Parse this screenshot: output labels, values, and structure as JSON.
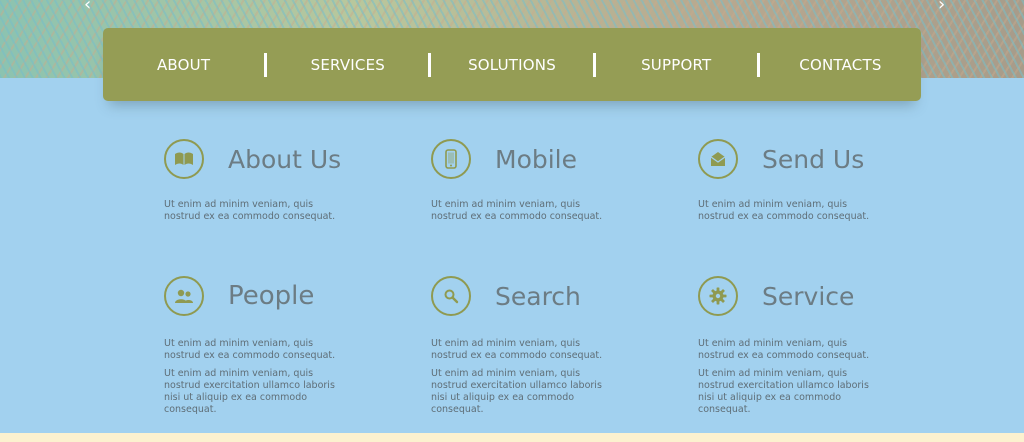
{
  "nav": {
    "items": [
      "ABOUT",
      "SERVICES",
      "SOLUTIONS",
      "SUPPORT",
      "CONTACTS"
    ]
  },
  "features": [
    {
      "title": "About Us",
      "icon": "book-icon",
      "paragraphs": [
        "Ut enim ad minim veniam, quis nostrud ex ea commodo consequat."
      ]
    },
    {
      "title": "Mobile",
      "icon": "mobile-phone-icon",
      "paragraphs": [
        "Ut enim ad minim veniam, quis nostrud ex ea commodo consequat."
      ]
    },
    {
      "title": "Send Us",
      "icon": "envelope-icon",
      "paragraphs": [
        "Ut enim ad minim veniam, quis nostrud ex ea commodo consequat."
      ]
    },
    {
      "title": "People",
      "icon": "people-icon",
      "paragraphs": [
        "Ut enim ad minim veniam, quis nostrud ex ea commodo consequat.",
        "Ut enim ad minim veniam, quis nostrud exercitation ullamco laboris nisi ut aliquip ex ea commodo consequat."
      ]
    },
    {
      "title": "Search",
      "icon": "search-icon",
      "paragraphs": [
        "Ut enim ad minim veniam, quis nostrud ex ea commodo consequat.",
        "Ut enim ad minim veniam, quis nostrud exercitation ullamco laboris nisi ut aliquip ex ea commodo consequat."
      ]
    },
    {
      "title": "Service",
      "icon": "gear-icon",
      "paragraphs": [
        "Ut enim ad minim veniam, quis nostrud ex ea commodo consequat.",
        "Ut enim ad minim veniam, quis nostrud exercitation ullamco laboris nisi ut aliquip ex ea commodo consequat."
      ]
    }
  ],
  "colors": {
    "background": "#a2d1ef",
    "nav_bar": "#959d55",
    "accent_icon": "#8f9a51",
    "heading": "#6c7c84",
    "body_text": "#5f6e77",
    "footer_strip": "#fcf1cf"
  },
  "banner": {
    "left_arrow_icon": "chevron-left-icon",
    "right_arrow_icon": "chevron-right-icon"
  }
}
